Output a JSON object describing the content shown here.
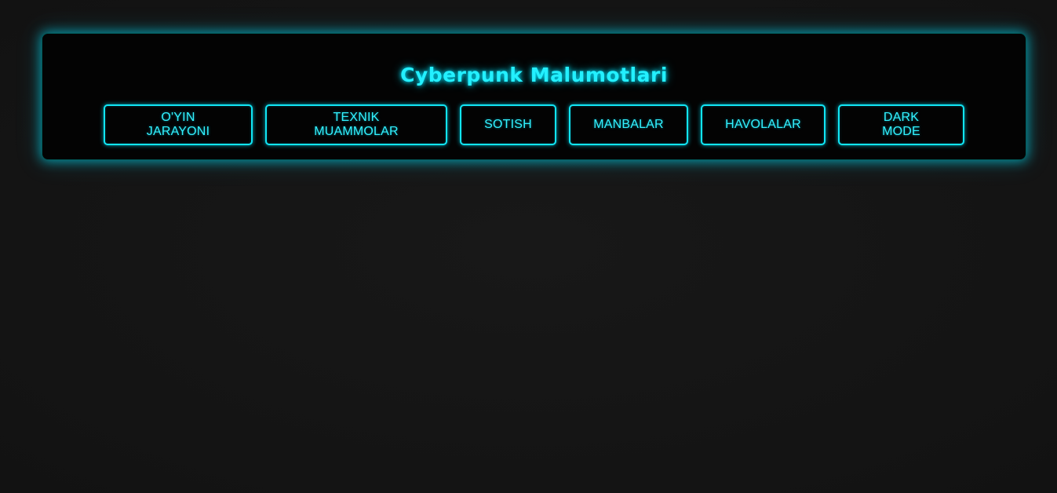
{
  "header": {
    "title": "Cyberpunk Malumotlari"
  },
  "nav": {
    "items": [
      {
        "label": "O'YIN JARAYONI"
      },
      {
        "label": "TEXNIK MUAMMOLAR"
      },
      {
        "label": "SOTISH"
      },
      {
        "label": "MANBALAR"
      },
      {
        "label": "HAVOLALAR"
      },
      {
        "label": "DARK MODE"
      }
    ]
  },
  "colors": {
    "accent": "#00e5ff",
    "panel_background": "#030303",
    "page_background": "#151515"
  }
}
